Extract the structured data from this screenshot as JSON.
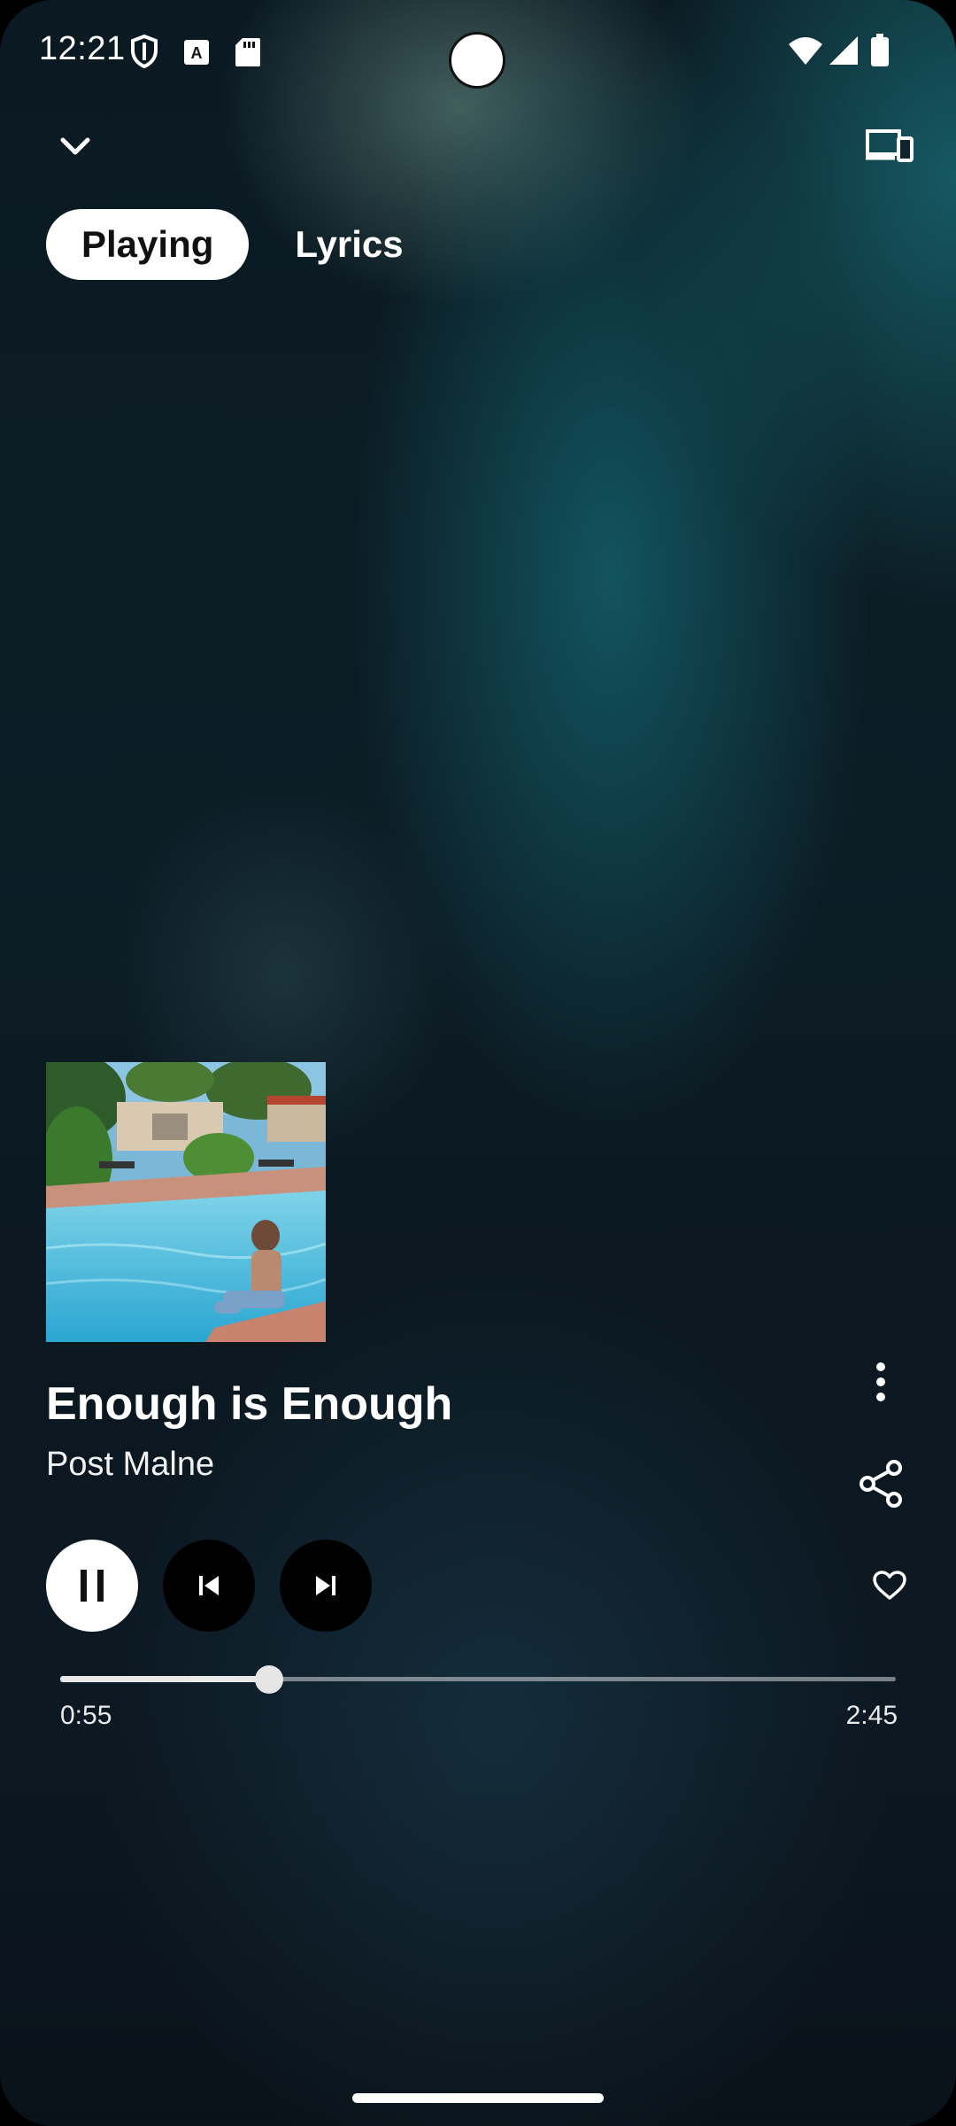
{
  "status_bar": {
    "time": "12:21",
    "left_icons": [
      "shield-icon",
      "font-a-icon",
      "sd-card-icon"
    ],
    "right_icons": [
      "wifi-icon",
      "signal-icon",
      "battery-icon"
    ]
  },
  "header": {
    "collapse_icon": "chevron-down-icon",
    "device_icon": "devices-icon"
  },
  "tabs": [
    {
      "label": "Playing",
      "active": true
    },
    {
      "label": "Lyrics",
      "active": false
    }
  ],
  "track": {
    "title": "Enough is Enough",
    "artist": "Post Malne"
  },
  "controls": {
    "play_state_icon": "pause-icon",
    "previous_icon": "skip-previous-icon",
    "next_icon": "skip-next-icon",
    "more_icon": "more-vertical-icon",
    "share_icon": "share-icon",
    "like_icon": "heart-outline-icon"
  },
  "playback": {
    "elapsed": "0:55",
    "total": "2:45",
    "progress_fraction": 0.25
  },
  "colors": {
    "accent": "#ffffff",
    "background_dark": "#0b1a22",
    "background_teal": "#146c78"
  }
}
